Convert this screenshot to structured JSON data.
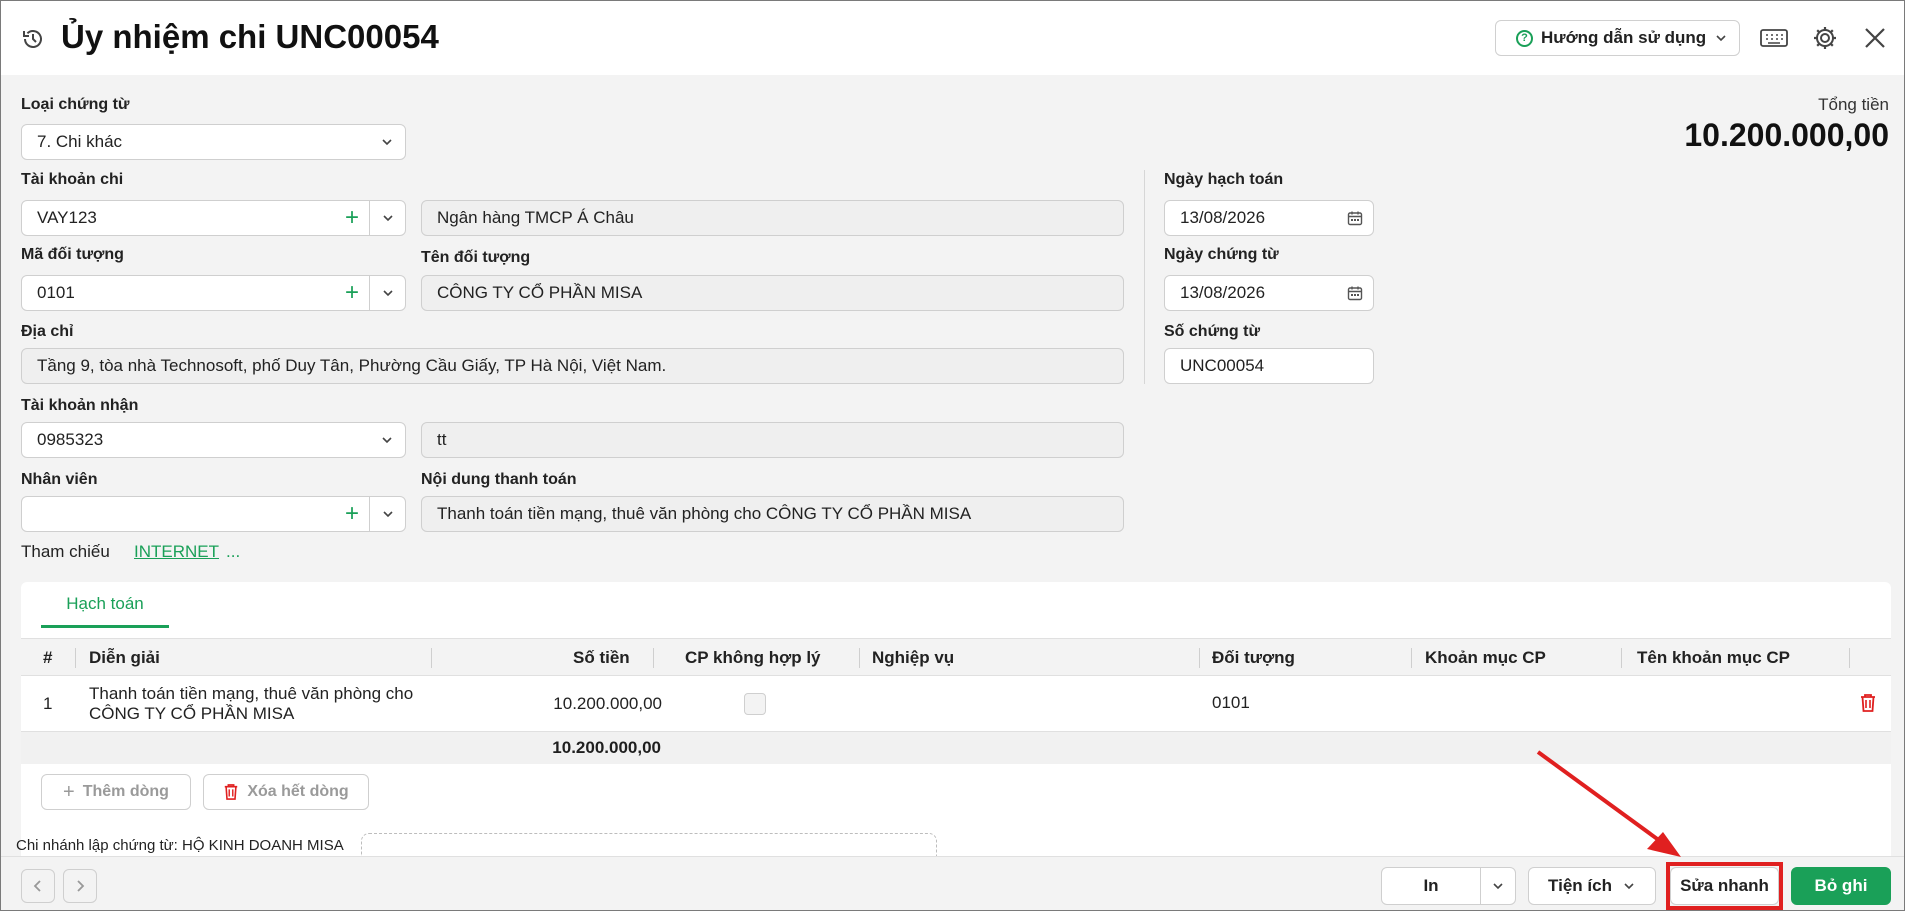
{
  "window": {
    "title": "Ủy nhiệm chi UNC00054",
    "help_label": "Hướng dẫn sử dụng"
  },
  "form": {
    "loai_chung_tu": {
      "label": "Loại chứng từ",
      "value": "7. Chi khác"
    },
    "tai_khoan_chi": {
      "label": "Tài khoản chi",
      "value": "VAY123",
      "bank_name": "Ngân hàng TMCP Á Châu"
    },
    "ma_doi_tuong": {
      "label": "Mã đối tượng",
      "value": "0101"
    },
    "ten_doi_tuong": {
      "label": "Tên đối tượng",
      "value": "CÔNG TY CỔ PHẦN MISA"
    },
    "dia_chi": {
      "label": "Địa chỉ",
      "value": "Tầng 9, tòa nhà Technosoft, phố Duy Tân, Phường Cầu Giấy, TP Hà Nội, Việt Nam."
    },
    "tai_khoan_nhan": {
      "label": "Tài khoản nhận",
      "value": "0985323",
      "bank_name": "tt"
    },
    "nhan_vien": {
      "label": "Nhân viên",
      "value": ""
    },
    "noi_dung": {
      "label": "Nội dung thanh toán",
      "value": "Thanh toán tiền mạng, thuê văn phòng cho CÔNG TY CỔ PHẦN MISA"
    },
    "ngay_hach_toan": {
      "label": "Ngày hạch toán",
      "value": "13/08/2026"
    },
    "ngay_chung_tu": {
      "label": "Ngày chứng từ",
      "value": "13/08/2026"
    },
    "so_chung_tu": {
      "label": "Số chứng từ",
      "value": "UNC00054"
    },
    "tong_tien": {
      "label": "Tổng tiền",
      "value": "10.200.000,00"
    },
    "tham_chieu": {
      "label": "Tham chiếu",
      "link": "INTERNET",
      "more": "..."
    }
  },
  "grid": {
    "tab": "Hạch toán",
    "columns": [
      "#",
      "Diễn giải",
      "Số tiền",
      "CP không hợp lý",
      "Nghiệp vụ",
      "Đối tượng",
      "Khoản mục CP",
      "Tên khoản mục CP"
    ],
    "rows": [
      {
        "index": "1",
        "dien_giai_line1": "Thanh toán tiền mạng, thuê văn phòng cho",
        "dien_giai_line2": "CÔNG TY CỔ PHẦN MISA",
        "so_tien": "10.200.000,00",
        "cp_khong_hop_ly": false,
        "nghiep_vu": "",
        "doi_tuong": "0101",
        "khoan_muc_cp": "",
        "ten_khoan_muc_cp": ""
      }
    ],
    "total": "10.200.000,00",
    "add_row_label": "Thêm dòng",
    "delete_all_label": "Xóa hết dòng"
  },
  "branch_text": "Chi nhánh lập chứng từ: HỘ KINH DOANH MISA",
  "footer": {
    "print_label": "In",
    "utilities_label": "Tiện ích",
    "quick_edit_label": "Sửa nhanh",
    "unpost_label": "Bỏ ghi"
  },
  "colors": {
    "accent": "#1aa058",
    "highlight": "#e02020",
    "delete": "#e02020"
  }
}
